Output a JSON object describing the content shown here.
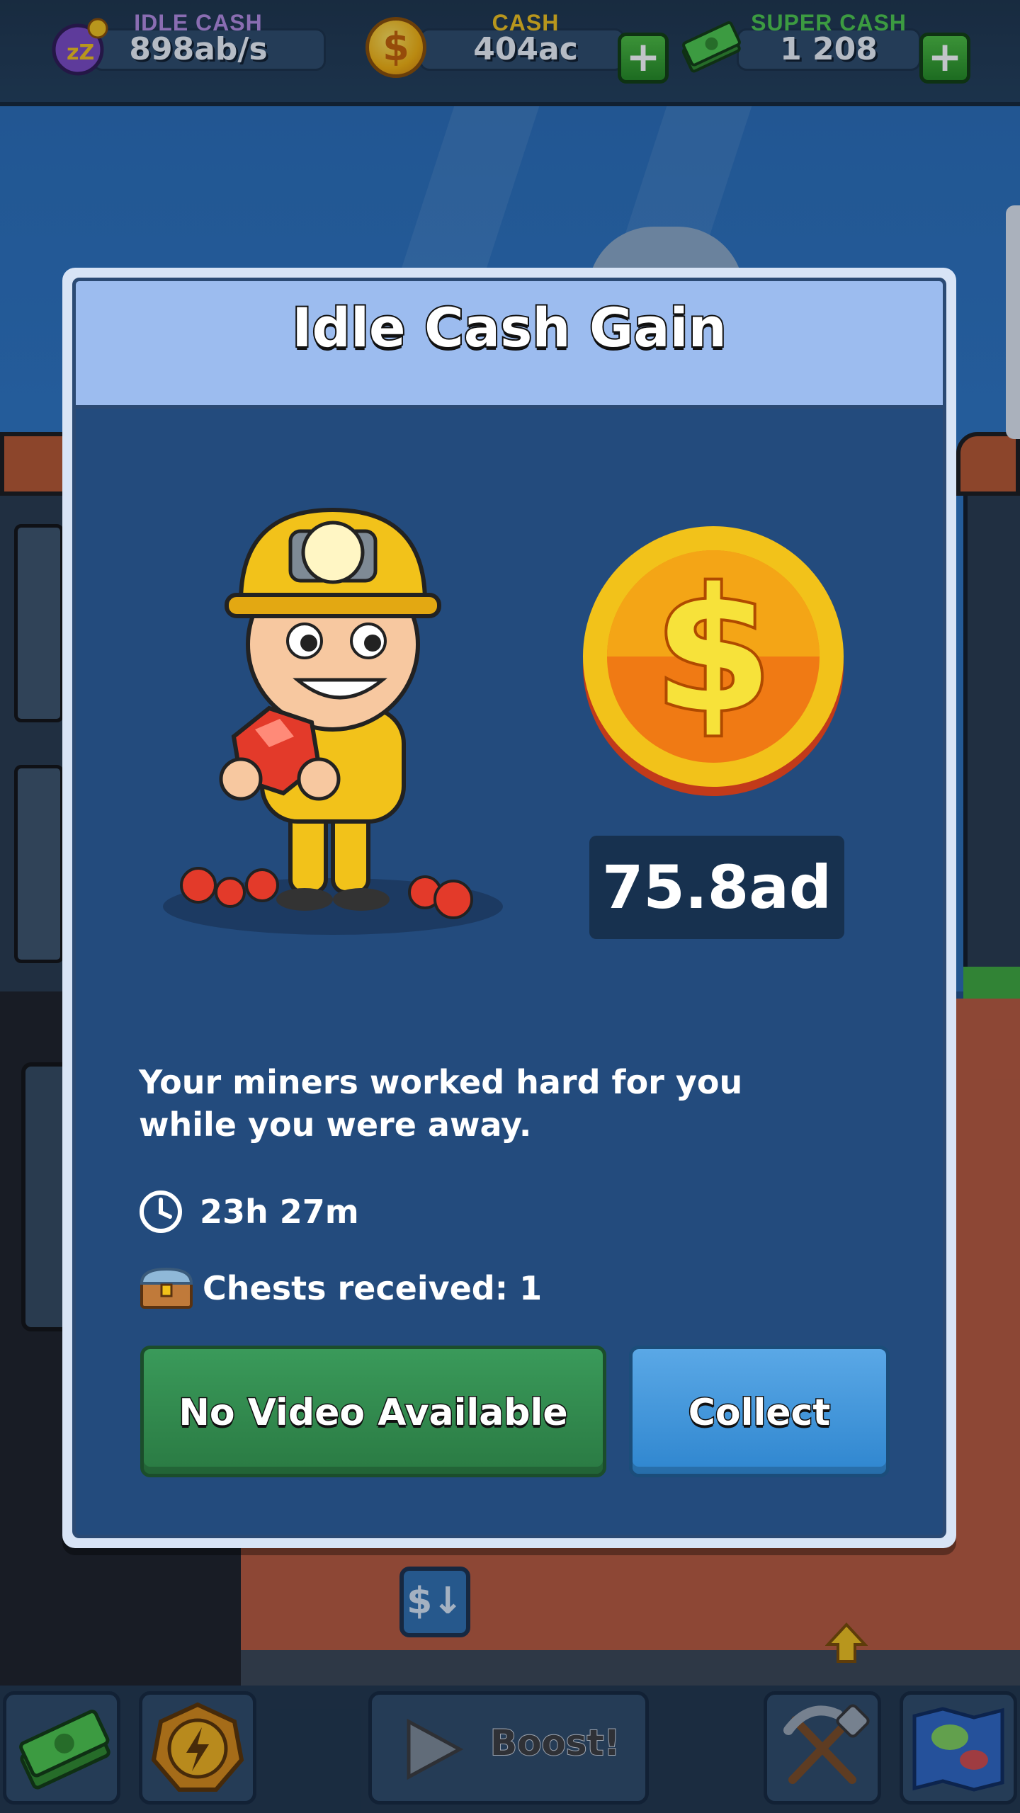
{
  "topbar": {
    "idle_cash": {
      "label": "IDLE CASH",
      "value": "898ab/s",
      "label_color": "#b48be0"
    },
    "cash": {
      "label": "CASH",
      "value": "404ac",
      "label_color": "#f2c21a"
    },
    "super_cash": {
      "label": "SUPER CASH",
      "value": "1 208",
      "label_color": "#4cc94a"
    },
    "plus_symbol": "+"
  },
  "modal": {
    "title": "Idle Cash Gain",
    "amount": "75.8ad",
    "description": "Your miners worked hard for you while you were away.",
    "time_away": "23h 27m",
    "chests_text": "Chests received: 1",
    "video_button": "No Video Available",
    "collect_button": "Collect"
  },
  "bottombar": {
    "boost_label": "Boost!"
  },
  "scene": {
    "elevator_icon": "$↓"
  },
  "colors": {
    "modal_bg": "#234b7d",
    "header_bg": "#9cbcef",
    "green_button": "#2a7a43",
    "blue_button": "#2f86cf"
  }
}
